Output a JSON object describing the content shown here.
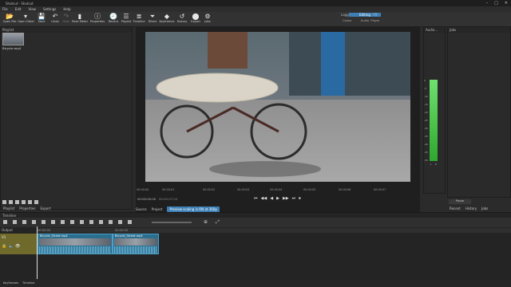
{
  "window": {
    "title": "Shotcut - Shotcut",
    "buttons": [
      "–",
      "□",
      "✕"
    ]
  },
  "menu": [
    "File",
    "Edit",
    "View",
    "Settings",
    "Help"
  ],
  "toolbar": [
    {
      "label": "Open File",
      "icon": "folder-open-icon",
      "glyph": "📂"
    },
    {
      "label": "Open Other",
      "icon": "open-other-icon",
      "glyph": "▾"
    },
    {
      "label": "Save",
      "icon": "save-icon",
      "glyph": "💾"
    },
    {
      "label": "Undo",
      "icon": "undo-icon",
      "glyph": "↶"
    },
    {
      "label": "Redo",
      "icon": "redo-icon",
      "glyph": "↷"
    },
    {
      "label": "Peak Meter",
      "icon": "peak-meter-icon",
      "glyph": "▮"
    },
    {
      "label": "Properties",
      "icon": "properties-icon",
      "glyph": "ⓘ"
    },
    {
      "label": "Recent",
      "icon": "recent-icon",
      "glyph": "🕘"
    },
    {
      "label": "Playlist",
      "icon": "playlist-icon",
      "glyph": "☰"
    },
    {
      "label": "Timeline",
      "icon": "timeline-icon",
      "glyph": "≣"
    },
    {
      "label": "Filters",
      "icon": "filter-icon",
      "glyph": "⏷"
    },
    {
      "label": "Keyframes",
      "icon": "keyframes-icon",
      "glyph": "◆"
    },
    {
      "label": "History",
      "icon": "history-icon",
      "glyph": "↺"
    },
    {
      "label": "Export",
      "icon": "export-icon",
      "glyph": "⬤"
    },
    {
      "label": "Jobs",
      "icon": "jobs-icon",
      "glyph": "⚙"
    }
  ],
  "layouts": [
    {
      "label": "Logging",
      "sub": "Colour"
    },
    {
      "label": "Editing",
      "sub": "Audio"
    },
    {
      "label": "FX",
      "sub": "Player"
    }
  ],
  "playlist": {
    "title": "Playlist",
    "clip_name": "Bicycle.mp4",
    "tabs": [
      "Playlist",
      "Properties",
      "Export"
    ]
  },
  "player": {
    "timecodes": [
      "00:00:00",
      "00:00:01",
      "00:00:02",
      "00:00:03",
      "00:00:04",
      "00:00:05",
      "00:00:06",
      "00:00:07"
    ],
    "current_time": "00:00:00:00",
    "total_time": "00:00:07:24",
    "tabs": [
      "Source",
      "Project"
    ],
    "preview_label": "Preview scaling is ON at 360p",
    "transport": [
      "⏮",
      "◀◀",
      "◀",
      "▶",
      "▶▶",
      "⏭",
      "⏹"
    ]
  },
  "audio": {
    "title": "Audio...",
    "scale": [
      "0",
      "-5",
      "-10",
      "-15",
      "-20",
      "-25",
      "-30",
      "-35",
      "-40",
      "-45",
      "-50"
    ],
    "channels": [
      "L",
      "R"
    ],
    "level_db": -5
  },
  "jobs": {
    "title": "Jobs",
    "pause_label": "Pause",
    "tabs": [
      "Recent",
      "History",
      "Jobs"
    ]
  },
  "timeline": {
    "title": "Timeline",
    "ruler": [
      "00:00:00",
      "00:00:03"
    ],
    "output_label": "Output",
    "track_label": "V1",
    "clips": [
      {
        "label": "Bicycle_Street.mp4"
      },
      {
        "label": "Bicycle_Street.mp4"
      }
    ]
  },
  "bottom_tabs": [
    "Keyframes",
    "Timeline"
  ]
}
